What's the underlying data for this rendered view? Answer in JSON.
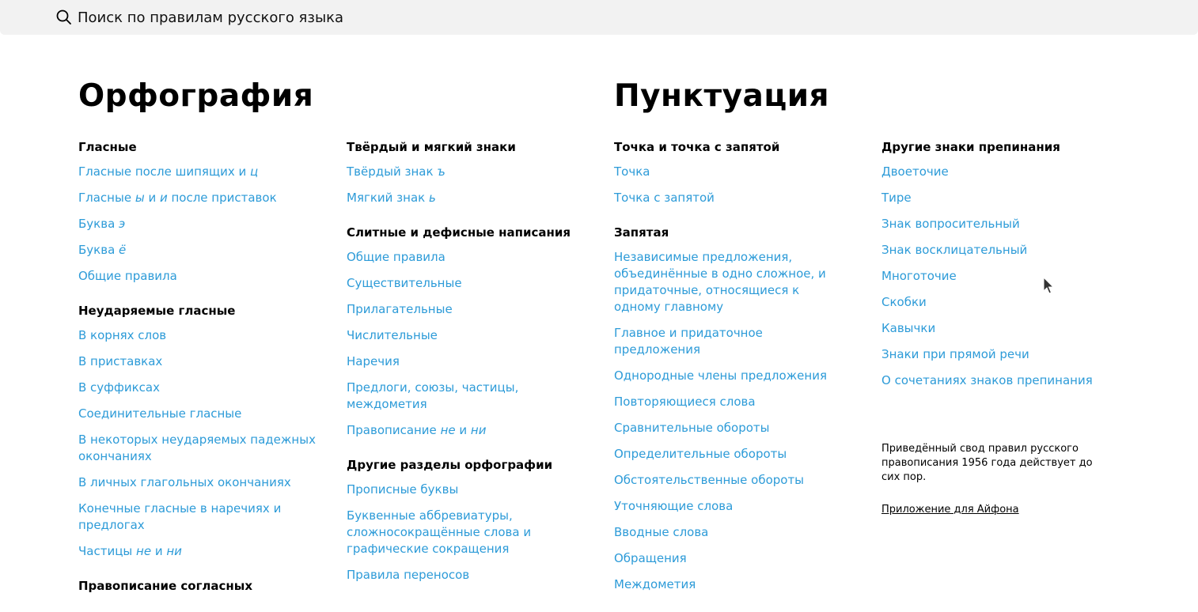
{
  "search": {
    "placeholder": "Поиск по правилам русского языка"
  },
  "sections": {
    "orthography": {
      "title": "Орфография",
      "col1": [
        {
          "title": "Гласные",
          "items": [
            {
              "parts": [
                {
                  "t": "Гласные после шипящих и "
                },
                {
                  "t": "ц",
                  "em": true
                }
              ]
            },
            {
              "parts": [
                {
                  "t": "Гласные "
                },
                {
                  "t": "ы",
                  "em": true
                },
                {
                  "t": " и "
                },
                {
                  "t": "и",
                  "em": true
                },
                {
                  "t": " после приставок"
                }
              ]
            },
            {
              "parts": [
                {
                  "t": "Буква "
                },
                {
                  "t": "э",
                  "em": true
                }
              ]
            },
            {
              "parts": [
                {
                  "t": "Буква "
                },
                {
                  "t": "ё",
                  "em": true
                }
              ]
            },
            {
              "parts": [
                {
                  "t": "Общие правила"
                }
              ]
            }
          ]
        },
        {
          "title": "Неударяемые гласные",
          "items": [
            {
              "parts": [
                {
                  "t": "В корнях слов"
                }
              ]
            },
            {
              "parts": [
                {
                  "t": "В приставках"
                }
              ]
            },
            {
              "parts": [
                {
                  "t": "В суффиксах"
                }
              ]
            },
            {
              "parts": [
                {
                  "t": "Соединительные гласные"
                }
              ]
            },
            {
              "parts": [
                {
                  "t": "В некоторых неударяемых падежных окончаниях"
                }
              ]
            },
            {
              "parts": [
                {
                  "t": "В личных глагольных окончаниях"
                }
              ]
            },
            {
              "parts": [
                {
                  "t": "Конечные гласные в наречиях и предлогах"
                }
              ]
            },
            {
              "parts": [
                {
                  "t": "Частицы "
                },
                {
                  "t": "не",
                  "em": true
                },
                {
                  "t": " и "
                },
                {
                  "t": "ни",
                  "em": true
                }
              ]
            }
          ]
        },
        {
          "title": "Правописание согласных",
          "items": []
        }
      ],
      "col2": [
        {
          "title": "Твёрдый и мягкий знаки",
          "items": [
            {
              "parts": [
                {
                  "t": "Твёрдый знак "
                },
                {
                  "t": "ъ",
                  "em": true
                }
              ]
            },
            {
              "parts": [
                {
                  "t": "Мягкий знак "
                },
                {
                  "t": "ь",
                  "em": true
                }
              ]
            }
          ]
        },
        {
          "title": "Слитные и дефисные написания",
          "items": [
            {
              "parts": [
                {
                  "t": "Общие правила"
                }
              ]
            },
            {
              "parts": [
                {
                  "t": "Существительные"
                }
              ]
            },
            {
              "parts": [
                {
                  "t": "Прилагательные"
                }
              ]
            },
            {
              "parts": [
                {
                  "t": "Числительные"
                }
              ]
            },
            {
              "parts": [
                {
                  "t": "Наречия"
                }
              ]
            },
            {
              "parts": [
                {
                  "t": "Предлоги, союзы, частицы, междометия"
                }
              ]
            },
            {
              "parts": [
                {
                  "t": "Правописание "
                },
                {
                  "t": "не",
                  "em": true
                },
                {
                  "t": " и "
                },
                {
                  "t": "ни",
                  "em": true
                }
              ]
            }
          ]
        },
        {
          "title": "Другие разделы орфографии",
          "items": [
            {
              "parts": [
                {
                  "t": "Прописные буквы"
                }
              ]
            },
            {
              "parts": [
                {
                  "t": "Буквенные аббревиатуры, сложносокращённые слова и графические сокращения"
                }
              ]
            },
            {
              "parts": [
                {
                  "t": "Правила переносов"
                }
              ]
            }
          ]
        }
      ]
    },
    "punctuation": {
      "title": "Пунктуация",
      "col3": [
        {
          "title": "Точка и точка с запятой",
          "items": [
            {
              "parts": [
                {
                  "t": "Точка"
                }
              ]
            },
            {
              "parts": [
                {
                  "t": "Точка с запятой"
                }
              ]
            }
          ]
        },
        {
          "title": "Запятая",
          "items": [
            {
              "parts": [
                {
                  "t": "Независимые предложения, объединённые в одно сложное, и придаточные, относящиеся к одному главному"
                }
              ]
            },
            {
              "parts": [
                {
                  "t": "Главное и придаточное предложения"
                }
              ]
            },
            {
              "parts": [
                {
                  "t": "Однородные члены предложения"
                }
              ]
            },
            {
              "parts": [
                {
                  "t": "Повторяющиеся слова"
                }
              ]
            },
            {
              "parts": [
                {
                  "t": "Сравнительные обороты"
                }
              ]
            },
            {
              "parts": [
                {
                  "t": "Определительные обороты"
                }
              ]
            },
            {
              "parts": [
                {
                  "t": "Обстоятельственные обороты"
                }
              ]
            },
            {
              "parts": [
                {
                  "t": "Уточняющие слова"
                }
              ]
            },
            {
              "parts": [
                {
                  "t": "Вводные слова"
                }
              ]
            },
            {
              "parts": [
                {
                  "t": "Обращения"
                }
              ]
            },
            {
              "parts": [
                {
                  "t": "Междометия"
                }
              ]
            }
          ]
        }
      ],
      "col4": [
        {
          "title": "Другие знаки препинания",
          "items": [
            {
              "parts": [
                {
                  "t": "Двоеточие"
                }
              ]
            },
            {
              "parts": [
                {
                  "t": "Тире"
                }
              ]
            },
            {
              "parts": [
                {
                  "t": "Знак вопросительный"
                }
              ]
            },
            {
              "parts": [
                {
                  "t": "Знак восклицательный"
                }
              ]
            },
            {
              "parts": [
                {
                  "t": "Многоточие"
                }
              ]
            },
            {
              "parts": [
                {
                  "t": "Скобки"
                }
              ]
            },
            {
              "parts": [
                {
                  "t": "Кавычки"
                }
              ]
            },
            {
              "parts": [
                {
                  "t": "Знаки при прямой речи"
                }
              ]
            },
            {
              "parts": [
                {
                  "t": "О сочетаниях знаков препинания"
                }
              ]
            }
          ]
        }
      ]
    }
  },
  "footer": {
    "note": "Приведённый свод правил русского правописания 1956 года действует до сих пор.",
    "app_link": "Приложение для Айфона"
  },
  "colors": {
    "link": "#2d9bd8",
    "search_bg": "#f2f2f2"
  }
}
